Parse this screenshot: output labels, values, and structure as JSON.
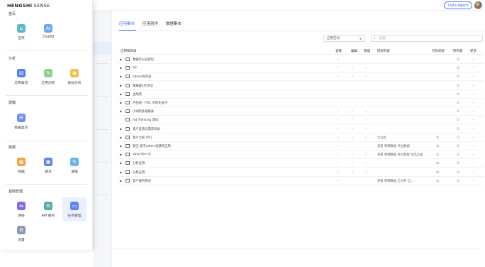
{
  "header": {
    "agent_button": "Data Agent"
  },
  "tabs": [
    {
      "label": "应用集市",
      "active": true
    },
    {
      "label": "应用创作",
      "active": false
    },
    {
      "label": "数据集市",
      "active": false
    }
  ],
  "filter": {
    "select_value": "应用空间",
    "search_placeholder": "搜索"
  },
  "table": {
    "columns": [
      "应用和目录",
      "查看",
      "编辑",
      "管理",
      "授权列表",
      "行权权限",
      "所有者",
      "更多"
    ],
    "rows": [
      {
        "type": "folder",
        "expand": true,
        "name": "数据可以这样玩",
        "view": "✓",
        "edit": "",
        "manage": "",
        "auth": "",
        "rowperm": "",
        "owner": "⊙",
        "more": "···"
      },
      {
        "type": "folder",
        "expand": true,
        "name": "kjs",
        "view": "✓",
        "edit": "✓",
        "manage": "✓",
        "auth": "",
        "rowperm": "",
        "owner": "⊙",
        "more": "···"
      },
      {
        "type": "folder",
        "expand": true,
        "name": "admin的目录",
        "view": "✓",
        "edit": "✓",
        "manage": "✓",
        "auth": "",
        "rowperm": "",
        "owner": "⊙",
        "more": "···"
      },
      {
        "type": "folder",
        "expand": true,
        "name": "邮箱看4月活动",
        "view": "",
        "edit": "",
        "manage": "",
        "auth": "",
        "rowperm": "",
        "owner": "⊙",
        "more": "···"
      },
      {
        "type": "folder",
        "expand": true,
        "name": "主线案",
        "view": "",
        "edit": "",
        "manage": "",
        "auth": "",
        "rowperm": "",
        "owner": "⊙",
        "more": "···"
      },
      {
        "type": "folder",
        "expand": true,
        "name": "产品线 - POC 可视化支持",
        "view": "",
        "edit": "",
        "manage": "",
        "auth": "",
        "rowperm": "",
        "owner": "⊙",
        "more": "···"
      },
      {
        "type": "folder",
        "expand": true,
        "name": "小湖的多维报表",
        "view": "✓",
        "edit": "✓",
        "manage": "✓",
        "auth": "",
        "rowperm": "",
        "owner": "⊙",
        "more": "···"
      },
      {
        "type": "folder",
        "expand": false,
        "name": "Fat Thinking 测试",
        "view": "✓",
        "edit": "✓",
        "manage": "✓",
        "auth": "",
        "rowperm": "",
        "owner": "⊙",
        "more": "···"
      },
      {
        "type": "folder",
        "expand": true,
        "name": "客户反馈与需求目录",
        "view": "✓",
        "edit": "✓",
        "manage": "✓",
        "auth": "",
        "rowperm": "",
        "owner": "⊙",
        "more": "···"
      },
      {
        "type": "app",
        "expand": true,
        "name": "客户大屏 (PC)",
        "view": "✓",
        "edit": "✓",
        "manage": "✓",
        "auth": "全分析",
        "rowperm": "⇆",
        "owner": "⊙",
        "more": "···"
      },
      {
        "type": "app",
        "expand": true,
        "name": "新应-基于admin创建的应用",
        "view": "✓",
        "edit": "",
        "manage": "",
        "auth": "查看 明细数据 导出数据",
        "rowperm": "⇆",
        "owner": "⊙",
        "more": "···"
      },
      {
        "type": "app",
        "expand": true,
        "name": "easy-dev-ck",
        "view": "✓",
        "edit": "✓",
        "manage": "✓",
        "auth": "查看 明细数据 导出数据 导出自由...",
        "rowperm": "⇆",
        "owner": "⊙",
        "more": "···"
      },
      {
        "type": "app",
        "expand": true,
        "name": "分析应用",
        "view": "✓",
        "edit": "✓",
        "manage": "✓",
        "auth": "",
        "rowperm": "⇆",
        "owner": "⊙",
        "more": "···"
      },
      {
        "type": "app",
        "expand": true,
        "name": "分析应用",
        "view": "✓",
        "edit": "✓",
        "manage": "✓",
        "auth": "",
        "rowperm": "⇆",
        "owner": "⊙",
        "more": "···"
      },
      {
        "type": "app",
        "expand": true,
        "name": "客户服务情况",
        "view": "✓",
        "edit": "",
        "manage": "",
        "auth": "查看 明细数据 全分析 自...",
        "rowperm": "⇆",
        "owner": "⊙",
        "more": "···"
      }
    ]
  },
  "panel": {
    "brand_bold": "HENGSHI",
    "brand_light": " SENSE",
    "sections": [
      {
        "title": "首页",
        "items": [
          {
            "label": "首页",
            "icon": "home-icon",
            "color": "#5bb9c9",
            "glyph": "⌂"
          },
          {
            "label": "ChatBI",
            "icon": "chatbi-icon",
            "color": "#6aa7f0",
            "glyph": "AI"
          }
        ]
      },
      {
        "title": "分析",
        "items": [
          {
            "label": "应用集市",
            "icon": "app-market-icon",
            "color": "#4f7ef3",
            "glyph": "▤"
          },
          {
            "label": "应用创作",
            "icon": "app-create-icon",
            "color": "#8ed08d",
            "glyph": "✎"
          },
          {
            "label": "指标分析",
            "icon": "metric-analysis-icon",
            "color": "#f2c14a",
            "glyph": "◉"
          }
        ]
      },
      {
        "title": "建模",
        "items": [
          {
            "label": "数据集市",
            "icon": "data-market-icon",
            "color": "#6d8ef0",
            "glyph": "☰"
          }
        ]
      },
      {
        "title": "数据",
        "items": [
          {
            "label": "数据",
            "icon": "data-icon",
            "color": "#f0a43d",
            "glyph": "▦"
          },
          {
            "label": "脚本",
            "icon": "script-icon",
            "color": "#5b86ee",
            "glyph": "▣"
          },
          {
            "label": "填报",
            "icon": "fill-report-icon",
            "color": "#66b7e8",
            "glyph": "✎"
          }
        ]
      },
      {
        "title": "基础管理",
        "items": [
          {
            "label": "连接",
            "icon": "connection-icon",
            "color": "#7c6ee8",
            "glyph": "⇋"
          },
          {
            "label": "API 服务",
            "icon": "api-service-icon",
            "color": "#5aa9a9",
            "glyph": "⚙"
          },
          {
            "label": "任务管理",
            "icon": "task-management-icon",
            "color": "#5b86ee",
            "glyph": "▭"
          },
          {
            "label": "设置",
            "icon": "settings-icon",
            "color": "#8a97b0",
            "glyph": "⚙"
          }
        ]
      }
    ]
  }
}
